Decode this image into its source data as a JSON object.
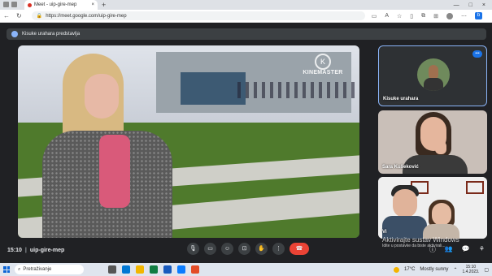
{
  "browser": {
    "tab_title": "Meet - uip-gire-mep",
    "tab_close": "×",
    "new_tab": "+",
    "url": "https://meet.google.com/uip-gire-mep",
    "window_controls": [
      "—",
      "□",
      "×"
    ]
  },
  "meet": {
    "presenting_text": "Kisuke urahara predstavlja",
    "watermark_brand": "KINEMASTER",
    "watermark_letter": "K",
    "participants": [
      {
        "name": "Kisuke urahara"
      },
      {
        "name": "Sara Kušeković"
      },
      {
        "name": "Vi"
      }
    ],
    "time": "15:10",
    "meeting_code": "uip-gire-mep",
    "separator": "|",
    "activation": {
      "title": "Aktivirajte sustav Windows",
      "subtitle": "Idite u postavke da biste aktivirali..."
    }
  },
  "taskbar": {
    "search_placeholder": "Pretraživanje",
    "temperature": "17°C",
    "weather": "Mostly sunny",
    "clock_time": "15:10",
    "clock_date": "1.4.2023."
  },
  "colors": {
    "end_call": "#ea4335",
    "accent": "#8ab4f8",
    "meet_bg": "#202124"
  }
}
